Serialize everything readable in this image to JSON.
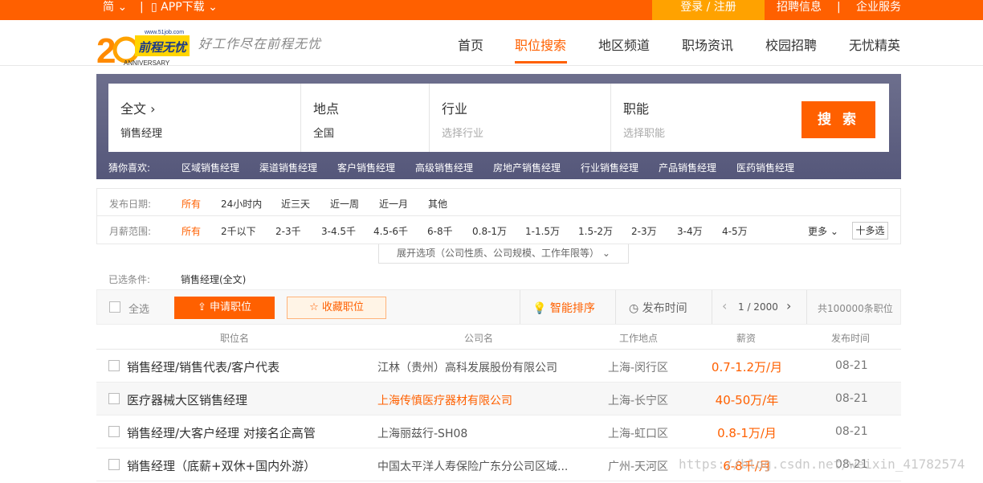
{
  "topbar": {
    "lang": "简",
    "app": "APP下载",
    "login": "登录 / 注册",
    "recruit": "招聘信息",
    "sep": "|",
    "enterprise": "企业服务"
  },
  "brand": {
    "logo_url": "www.51job.com",
    "logo_name": "前程无忧",
    "logo_anniv": "ANNIVERSARY",
    "slogan": "好工作尽在前程无忧"
  },
  "nav": [
    "首页",
    "职位搜索",
    "地区频道",
    "职场资讯",
    "校园招聘",
    "无忧精英"
  ],
  "search": {
    "fulltext_label": "全文",
    "fulltext_value": "销售经理",
    "location_label": "地点",
    "location_value": "全国",
    "industry_label": "行业",
    "industry_placeholder": "选择行业",
    "function_label": "职能",
    "function_placeholder": "选择职能",
    "button": "搜 索",
    "guess_label": "猜你喜欢:",
    "guess_items": [
      "区域销售经理",
      "渠道销售经理",
      "客户销售经理",
      "高级销售经理",
      "房地产销售经理",
      "行业销售经理",
      "产品销售经理",
      "医药销售经理"
    ]
  },
  "filters": {
    "date_label": "发布日期:",
    "date_options": [
      "所有",
      "24小时内",
      "近三天",
      "近一周",
      "近一月",
      "其他"
    ],
    "salary_label": "月薪范围:",
    "salary_options": [
      "所有",
      "2千以下",
      "2-3千",
      "3-4.5千",
      "4.5-6千",
      "6-8千",
      "0.8-1万",
      "1-1.5万",
      "1.5-2万",
      "2-3万",
      "3-4万",
      "4-5万"
    ],
    "more": "更多",
    "multi": "十多选",
    "expand": "展开选项（公司性质、公司规模、工作年限等）",
    "chosen_label": "已选条件:",
    "chosen_value": "销售经理(全文)"
  },
  "toolbar": {
    "select_all": "全选",
    "apply": "申请职位",
    "collect": "收藏职位",
    "smart_sort": "智能排序",
    "pub_time": "发布时间",
    "page": "1 / 2000",
    "total": "共100000条职位"
  },
  "table": {
    "headers": [
      "职位名",
      "公司名",
      "工作地点",
      "薪资",
      "发布时间"
    ],
    "rows": [
      {
        "title": "销售经理/销售代表/客户代表",
        "company": "江林（贵州）高科发展股份有限公司",
        "location": "上海-闵行区",
        "salary": "0.7-1.2万/月",
        "date": "08-21"
      },
      {
        "title": "医疗器械大区销售经理",
        "company": "上海传慎医疗器材有限公司",
        "location": "上海-长宁区",
        "salary": "40-50万/年",
        "date": "08-21"
      },
      {
        "title": "销售经理/大客户经理 对接名企高管",
        "company": "上海丽兹行-SH08",
        "location": "上海-虹口区",
        "salary": "0.8-1万/月",
        "date": "08-21"
      },
      {
        "title": "销售经理（底薪+双休+国内外游）",
        "company": "中国太平洋人寿保险广东分公司区域...",
        "location": "广州-天河区",
        "salary": "6-8千/月",
        "date": "08-21"
      }
    ]
  },
  "watermark": "https://blog.csdn.net/weixin_41782574",
  "colors": {
    "accent": "#ff6000",
    "login_bg": "#ffa200",
    "search_bg": "#5f6184"
  }
}
